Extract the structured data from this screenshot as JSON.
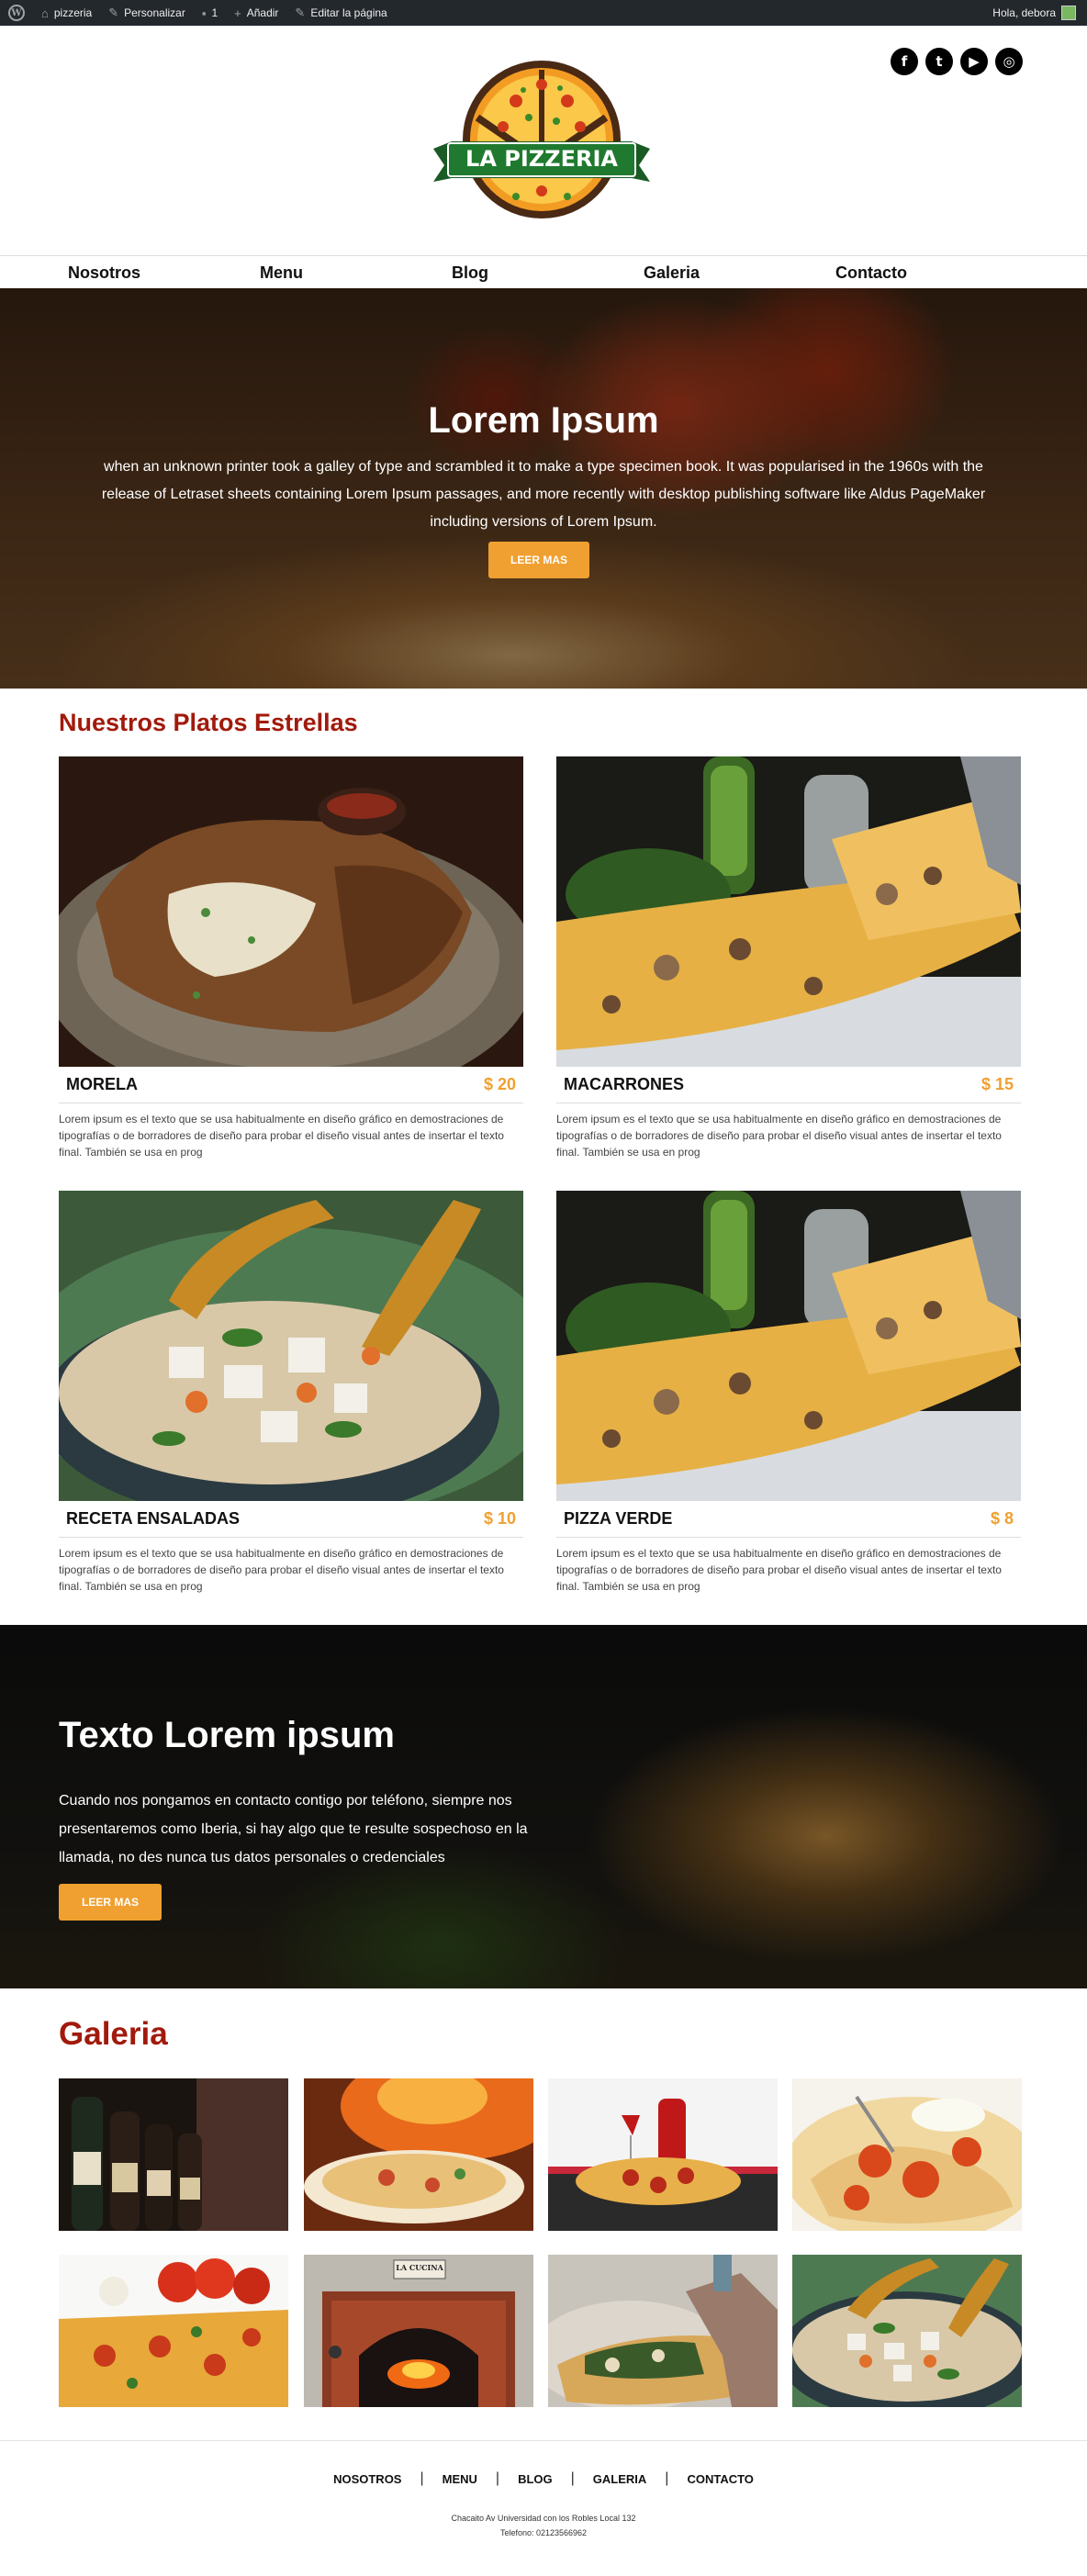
{
  "admin_bar": {
    "site_name": "pizzeria",
    "customize": "Personalizar",
    "comments_count": "1",
    "add_new": "Añadir",
    "edit_page": "Editar la página",
    "greeting": "Hola, debora"
  },
  "header": {
    "logo_text": "LA PIZZERIA",
    "social_icons": [
      "facebook-icon",
      "tumblr-icon",
      "youtube-icon",
      "instagram-icon"
    ]
  },
  "nav": {
    "items": [
      "Nosotros",
      "Menu",
      "Blog",
      "Galeria",
      "Contacto"
    ]
  },
  "hero": {
    "title": "Lorem Ipsum",
    "text": "when an unknown printer took a galley of type and scrambled it to make a type specimen book. It was popularised in the 1960s with the release of Letraset sheets containing Lorem Ipsum passages, and more recently with desktop publishing software like Aldus PageMaker including versions of Lorem Ipsum.",
    "button": "LEER MAS"
  },
  "platos": {
    "title": "Nuestros Platos Estrellas",
    "items": [
      {
        "name": "MORELA",
        "price": "$ 20",
        "desc": "Lorem ipsum es el texto que se usa habitualmente en diseño gráfico en demostraciones de tipografías o de borradores de diseño para probar el diseño visual antes de insertar el texto final. También se usa en prog"
      },
      {
        "name": "MACARRONES",
        "price": "$ 15",
        "desc": "Lorem ipsum es el texto que se usa habitualmente en diseño gráfico en demostraciones de tipografías o de borradores de diseño para probar el diseño visual antes de insertar el texto final. También se usa en prog"
      },
      {
        "name": "RECETA ENSALADAS",
        "price": "$ 10",
        "desc": "Lorem ipsum es el texto que se usa habitualmente en diseño gráfico en demostraciones de tipografías o de borradores de diseño para probar el diseño visual antes de insertar el texto final. También se usa en prog"
      },
      {
        "name": "PIZZA VERDE",
        "price": "$ 8",
        "desc": "Lorem ipsum es el texto que se usa habitualmente en diseño gráfico en demostraciones de tipografías o de borradores de diseño para probar el diseño visual antes de insertar el texto final. También se usa en prog"
      }
    ]
  },
  "promo": {
    "title": "Texto Lorem ipsum",
    "text": "Cuando nos pongamos en contacto contigo por teléfono, siempre nos presentaremos como Iberia, si hay algo que te resulte sospechoso en la llamada, no des nunca tus datos personales o credenciales",
    "button": "LEER MAS"
  },
  "galeria": {
    "title": "Galeria",
    "oven_sign": "LA CUCINA"
  },
  "footer": {
    "nav": [
      "NOSOTROS",
      "MENU",
      "BLOG",
      "GALERIA",
      "CONTACTO"
    ],
    "address": "Chacaito Av Universidad con los Robles Local 132",
    "phone": "Telefono: 02123566962"
  },
  "colors": {
    "accent": "#f0a030",
    "title_red": "#a11a0c",
    "admin_bar": "#23282d",
    "logo_green": "#1f7a2f"
  }
}
